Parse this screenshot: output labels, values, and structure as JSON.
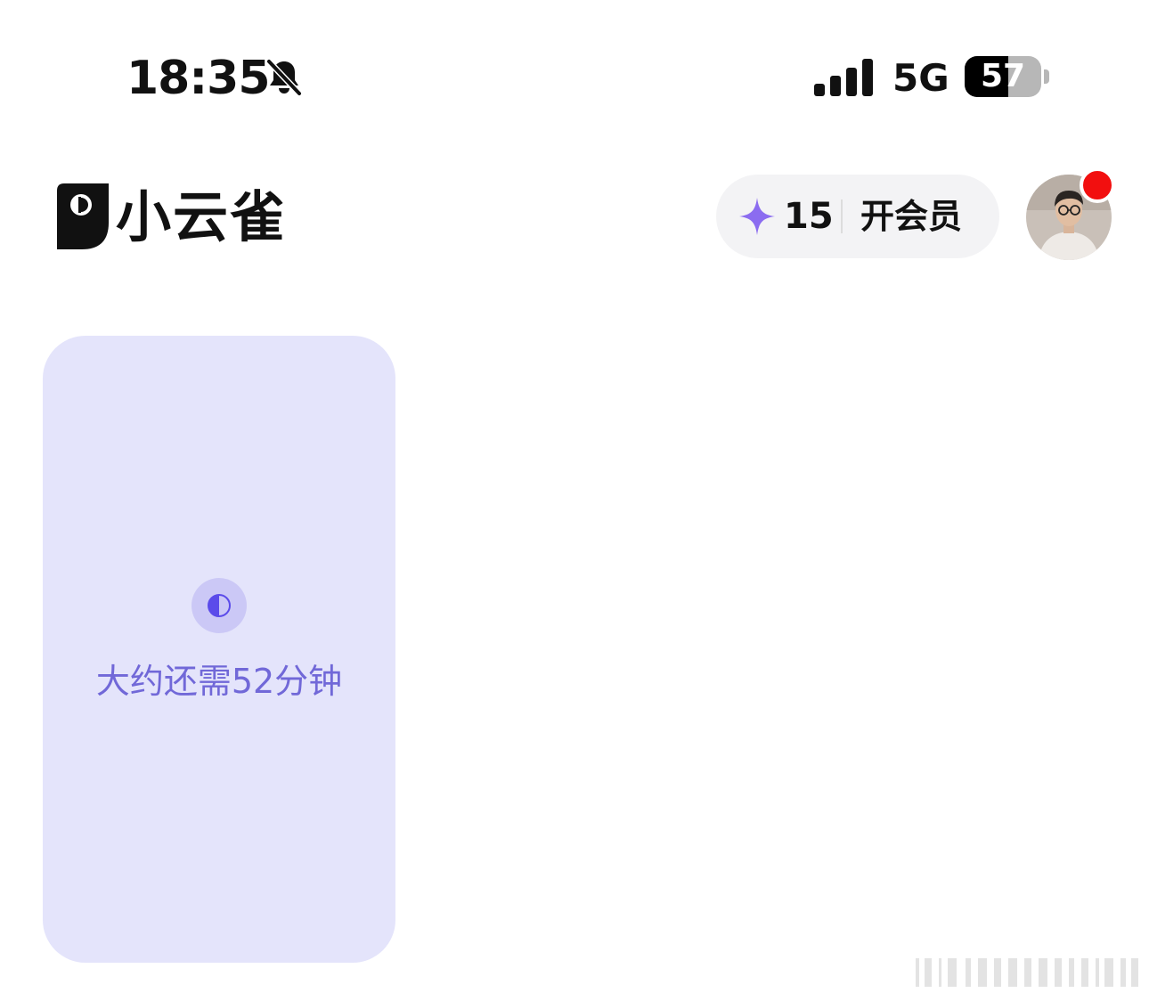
{
  "status_bar": {
    "time": "18:35",
    "mute_icon": "bell-slash-icon",
    "network": "5G",
    "signal_bars": 4,
    "battery_level": "57",
    "battery_fraction": 0.57
  },
  "header": {
    "app_name": "小云雀",
    "logo_icon": "bird-logo-icon",
    "credits": {
      "icon": "sparkle-icon",
      "count": "15",
      "vip_label": "开会员"
    },
    "avatar": {
      "icon": "user-avatar",
      "has_notification": true
    }
  },
  "task_card": {
    "progress_icon": "half-moon-progress-icon",
    "remaining_text": "大约还需52分钟"
  },
  "colors": {
    "accent": "#7168d8",
    "card_bg": "#e4e4fb",
    "sparkle": "#8b6cf0",
    "notification": "#f20f0f",
    "pill_bg": "#f3f3f5"
  }
}
